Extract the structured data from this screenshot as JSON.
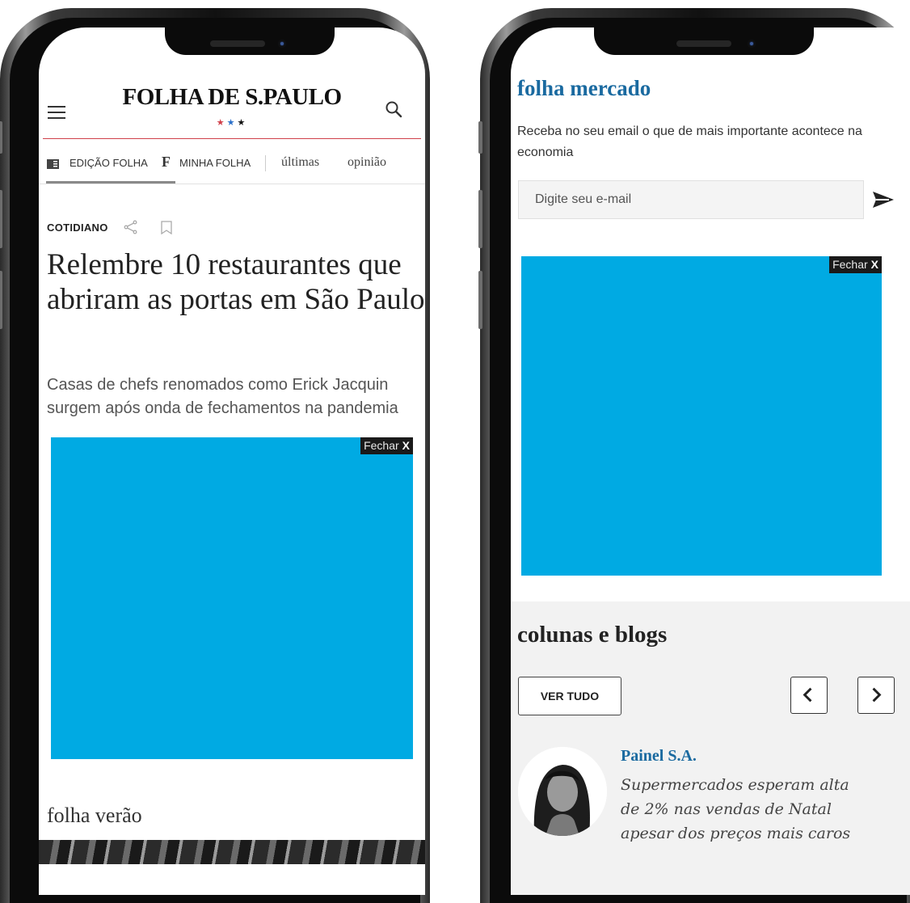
{
  "left_phone": {
    "header": {
      "logo": "FOLHA DE S.PAULO",
      "stars": "★★★"
    },
    "nav": {
      "edicao": "EDIÇÃO FOLHA",
      "minha_f": "F",
      "minha": "MINHA FOLHA",
      "ultimas": "últimas",
      "opiniao": "opinião"
    },
    "article": {
      "section": "COTIDIANO",
      "headline": "Relembre 10 restaurantes que abriram as portas em São Paulo",
      "subtitle": "Casas de chefs renomados como Erick Jacquin surgem após onda de fechamentos na pandemia"
    },
    "ad": {
      "close_label": "Fechar",
      "close_x": "X",
      "color": "#00aae3"
    },
    "next_section": "folha verão"
  },
  "right_phone": {
    "newsletter": {
      "title": "folha mercado",
      "description": "Receba no seu email o que de mais importante acontece na economia",
      "email_placeholder": "Digite seu e-mail"
    },
    "ad": {
      "close_label": "Fechar",
      "close_x": "X",
      "color": "#00aae3"
    },
    "columns": {
      "title": "colunas e blogs",
      "see_all": "VER TUDO",
      "item": {
        "name": "Painel S.A.",
        "headline": "Supermercados esperam alta de 2% nas vendas de Natal apesar dos preços mais caros"
      }
    }
  },
  "colors": {
    "link_blue": "#1a6aa0",
    "ad_blue": "#00aae3",
    "rule_red": "#d0404a"
  }
}
